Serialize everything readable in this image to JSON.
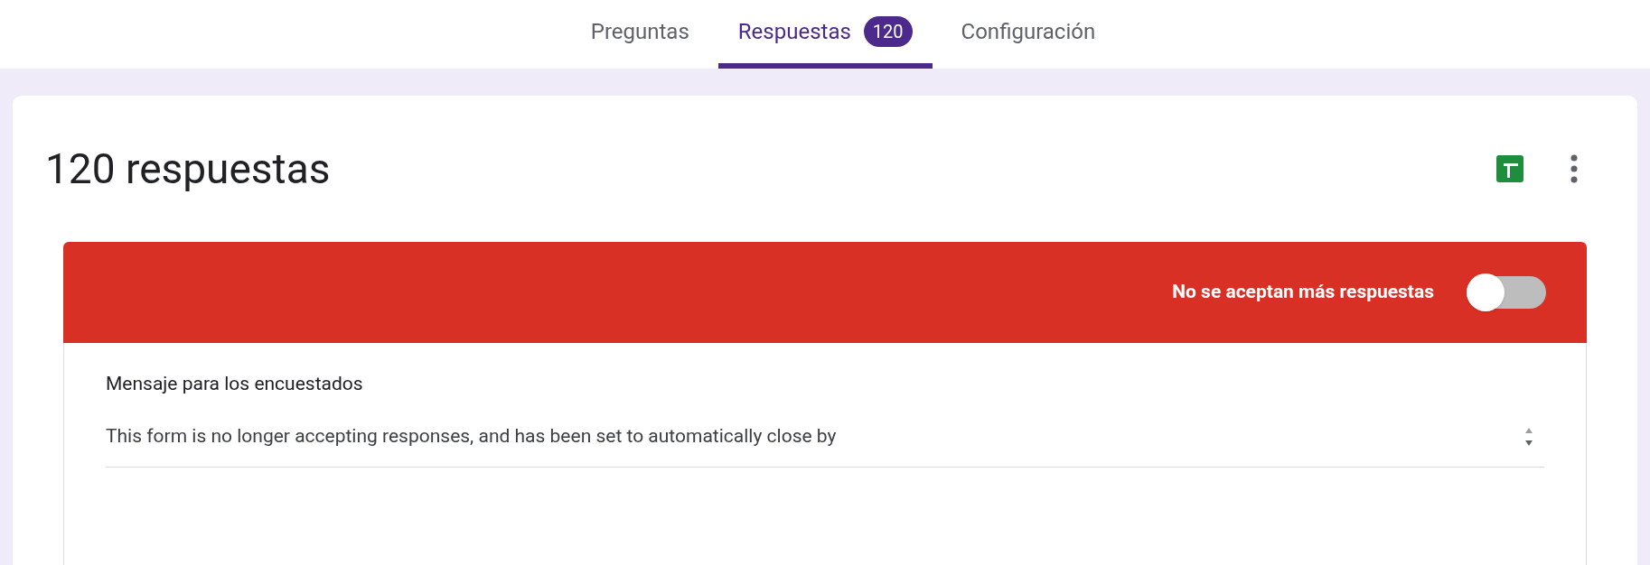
{
  "tabs": [
    {
      "label": "Preguntas",
      "selected": false
    },
    {
      "label": "Respuestas",
      "selected": true,
      "badge": "120"
    },
    {
      "label": "Configuración",
      "selected": false
    }
  ],
  "title": "120 respuestas",
  "banner": {
    "label": "No se aceptan más respuestas",
    "on": false
  },
  "message": {
    "label": "Mensaje para los encuestados",
    "value": "This form is no longer accepting responses, and has been set to automatically close by"
  }
}
